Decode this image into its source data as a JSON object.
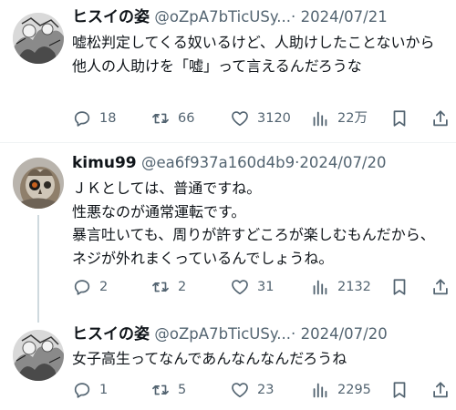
{
  "posts": [
    {
      "display_name": "ヒスイの姿",
      "handle": "@oZpA7bTicUSy...",
      "separator": "·",
      "date": "2024/07/21",
      "text": "嘘松判定してくる奴いるけど、人助けしたことないから他人の人助けを「嘘」って言えるんだろうな",
      "replies": "18",
      "reposts": "66",
      "likes": "3120",
      "views": "22万",
      "avatar_icon": "manga-illustration-avatar"
    },
    {
      "display_name": "kimu99",
      "handle": "@ea6f937a160d4b9",
      "separator": "·",
      "date": "2024/07/20",
      "text": "ＪＫとしては、普通ですね。\n性悪なのが通常運転です。\n暴言吐いても、周りが許すどころが楽しむもんだから、ネジが外れまくっているんでしょうね。",
      "replies": "2",
      "reposts": "2",
      "likes": "31",
      "views": "2132",
      "avatar_icon": "owl-photo-avatar"
    },
    {
      "display_name": "ヒスイの姿",
      "handle": "@oZpA7bTicUSy...",
      "separator": "·",
      "date": "2024/07/20",
      "text": "女子高生ってなんであんなんなんだろうね",
      "replies": "1",
      "reposts": "5",
      "likes": "23",
      "views": "2295",
      "avatar_icon": "manga-illustration-avatar"
    }
  ],
  "icons": {
    "reply": "reply-icon",
    "repost": "repost-icon",
    "like": "heart-icon",
    "views": "views-icon",
    "bookmark": "bookmark-icon",
    "share": "share-icon"
  },
  "colors": {
    "text": "#0f1419",
    "secondary": "#536471",
    "divider": "#eff3f4",
    "thread_line": "#cfd9de"
  }
}
